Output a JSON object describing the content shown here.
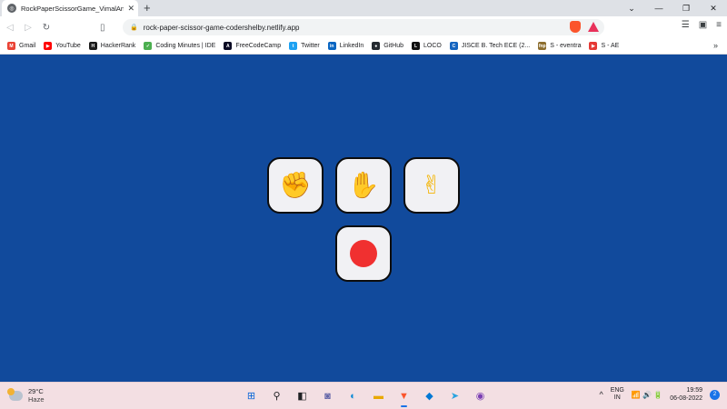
{
  "browser": {
    "tab_title": "RockPaperScissorGame_VimalAn",
    "tab_close": "✕",
    "new_tab": "+",
    "window_controls": {
      "dropdown": "⌄",
      "minimize": "—",
      "restore": "❐",
      "close": "✕"
    },
    "url": "rock-paper-scissor-game-codershelby.netlify.app",
    "more_bookmarks": "»"
  },
  "bookmarks": [
    {
      "label": "Gmail",
      "icon": "gmail-icon",
      "color": "#ea4335",
      "glyph": "M"
    },
    {
      "label": "YouTube",
      "icon": "youtube-icon",
      "color": "#ff0000",
      "glyph": "▶"
    },
    {
      "label": "HackerRank",
      "icon": "hackerrank-icon",
      "color": "#1b1b1b",
      "glyph": "H"
    },
    {
      "label": "Coding Minutes | IDE",
      "icon": "coding-minutes-icon",
      "color": "#4caf50",
      "glyph": "✓"
    },
    {
      "label": "FreeCodeCamp",
      "icon": "freecodecamp-icon",
      "color": "#0a0a23",
      "glyph": "A"
    },
    {
      "label": "Twitter",
      "icon": "twitter-icon",
      "color": "#1da1f2",
      "glyph": "t"
    },
    {
      "label": "LinkedIn",
      "icon": "linkedin-icon",
      "color": "#0a66c2",
      "glyph": "in"
    },
    {
      "label": "GitHub",
      "icon": "github-icon",
      "color": "#24292f",
      "glyph": "●"
    },
    {
      "label": "LOCO",
      "icon": "loco-icon",
      "color": "#111111",
      "glyph": "L"
    },
    {
      "label": "JISCE B. Tech ECE (2...",
      "icon": "jisce-icon",
      "color": "#1565c0",
      "glyph": "C"
    },
    {
      "label": "S - eventra",
      "icon": "eventra-icon",
      "color": "#8d6e2f",
      "glyph": "fnp"
    },
    {
      "label": "S - AE",
      "icon": "ae-icon",
      "color": "#e53935",
      "glyph": "▶"
    }
  ],
  "game": {
    "choices": [
      {
        "name": "rock",
        "glyph": "✊"
      },
      {
        "name": "paper",
        "glyph": "✋"
      },
      {
        "name": "scissors",
        "glyph": "✌"
      }
    ],
    "status_color": "#f03030",
    "background_color": "#114a9c"
  },
  "taskbar": {
    "temperature": "29°C",
    "condition": "Haze",
    "apps": [
      {
        "name": "start-icon",
        "glyph": "⊞",
        "color": "#0a66d8"
      },
      {
        "name": "search-icon",
        "glyph": "⚲",
        "color": "#202124"
      },
      {
        "name": "task-view-icon",
        "glyph": "◧",
        "color": "#202124"
      },
      {
        "name": "teams-chat-icon",
        "glyph": "◙",
        "color": "#6264a7"
      },
      {
        "name": "edge-icon",
        "glyph": "◐",
        "color": "#0c8ad6"
      },
      {
        "name": "file-explorer-icon",
        "glyph": "▬",
        "color": "#e8a800"
      },
      {
        "name": "brave-browser-icon",
        "glyph": "▼",
        "color": "#fb542b",
        "active": true
      },
      {
        "name": "vscode-icon",
        "glyph": "◆",
        "color": "#0078d4"
      },
      {
        "name": "telegram-icon",
        "glyph": "➤",
        "color": "#2aa3df"
      },
      {
        "name": "github-desktop-icon",
        "glyph": "◉",
        "color": "#7b3fb3"
      }
    ],
    "tray_caret": "^",
    "lang_1": "ENG",
    "lang_2": "IN",
    "tray_icons": "📶 🔊 🔋",
    "time": "19:59",
    "date": "06-08-2022",
    "notifications": "2"
  }
}
